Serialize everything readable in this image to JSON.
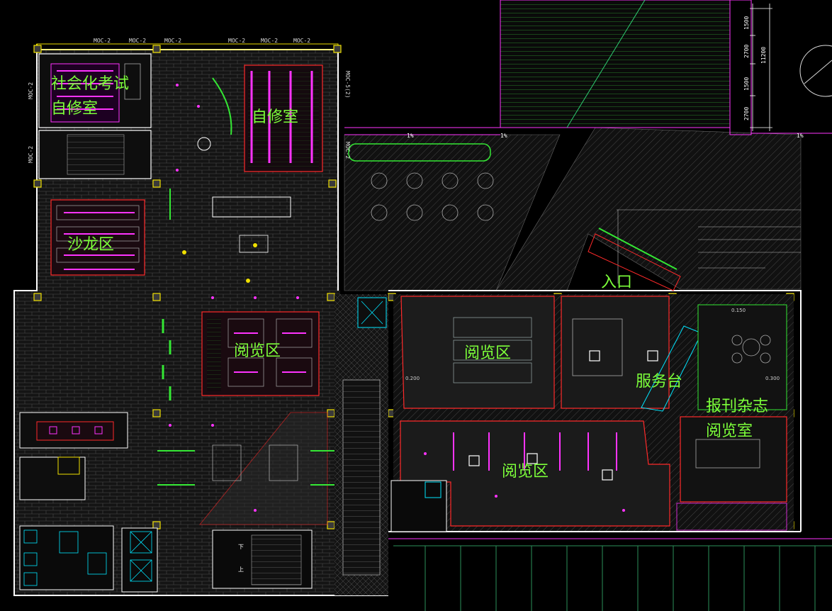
{
  "zones": {
    "exam_study_line1": "社会化考试",
    "exam_study_line2": "自修室",
    "study_room": "自修室",
    "salon": "沙龙区",
    "reading_west": "阅览区",
    "reading_north": "阅览区",
    "reading_south": "阅览区",
    "service_desk": "服务台",
    "entrance": "入口",
    "periodicals_line1": "报刊杂志",
    "periodicals_line2": "阅览室"
  },
  "tags": {
    "moc": "MOC-2",
    "moc_side": "MOC-5(2)",
    "stair_down": "下",
    "stair_up": "上"
  },
  "dimensions": {
    "d1": "1500",
    "d2": "2700",
    "d3": "1500",
    "d4": "2700",
    "total": "11200",
    "slope1": "1%",
    "slope2": "1%",
    "slope3": "1%",
    "level1": "0.150",
    "level2": "0.200",
    "level3": "0.300"
  },
  "colors": {
    "background": "#000000",
    "label": "#7CFF3A",
    "wall": "#ffffff",
    "cyan": "#00e5ff",
    "red": "#ff2a2a",
    "magenta": "#ff33ff",
    "yellow": "#f0e000",
    "green": "#34e834"
  }
}
